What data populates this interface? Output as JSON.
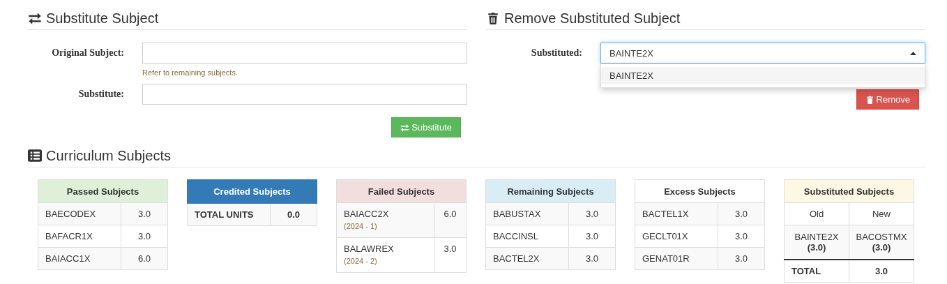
{
  "substitute": {
    "title": "Substitute Subject",
    "fields": [
      {
        "label": "Original Subject:",
        "help": "Refer to remaining subjects."
      },
      {
        "label": "Substitute:"
      }
    ],
    "button": "Substitute"
  },
  "remove": {
    "title": "Remove Substituted Subject",
    "select": {
      "label": "Substituted:",
      "value": "BAINTE2X",
      "expanded": true,
      "options": [
        {
          "label": "BAINTE2X",
          "highlighted": true
        }
      ]
    },
    "button": "Remove"
  },
  "curriculum": {
    "title": "Curriculum Subjects",
    "tables": [
      {
        "kind": "units",
        "color": "#dff0d8",
        "title": "Passed Subjects",
        "rows": [
          {
            "subject": "BAECODEX",
            "units": "3.0"
          },
          {
            "subject": "BAFACR1X",
            "units": "3.0"
          },
          {
            "subject": "BAIACC1X",
            "units": "6.0"
          }
        ]
      },
      {
        "kind": "units",
        "color": "#337ab7",
        "title": "Credited Subjects",
        "total": {
          "label": "TOTAL UNITS",
          "units": "0.0"
        }
      },
      {
        "kind": "units",
        "color": "#f2dede",
        "title": "Failed Subjects",
        "rows": [
          {
            "subject": "BAIACC2X",
            "term": "(2024 - 1)",
            "units": "6.0"
          },
          {
            "subject": "BALAWREX",
            "term": "(2024 - 2)",
            "units": "3.0"
          }
        ]
      },
      {
        "kind": "units",
        "color": "#d9edf7",
        "title": "Remaining Subjects",
        "rows": [
          {
            "subject": "BABUSTAX",
            "units": "3.0"
          },
          {
            "subject": "BACCINSL",
            "units": "3.0"
          },
          {
            "subject": "BACTEL2X",
            "units": "3.0"
          }
        ]
      },
      {
        "kind": "units",
        "color": "#ffffff",
        "title": "Excess Subjects",
        "rows": [
          {
            "subject": "BACTEL1X",
            "units": "3.0"
          },
          {
            "subject": "GECLT01X",
            "units": "3.0"
          },
          {
            "subject": "GENAT01R",
            "units": "3.0"
          }
        ]
      },
      {
        "kind": "substitution",
        "color": "#fcf8e3",
        "title": "Substituted Subjects",
        "columns": [
          "Old",
          "New"
        ],
        "rows": [
          {
            "old": "BAINTE2X",
            "old_units": "(3.0)",
            "new": "BACOSTMX",
            "new_units": "(3.0)"
          }
        ],
        "total": {
          "label": "TOTAL",
          "units": "3.0"
        }
      }
    ]
  }
}
